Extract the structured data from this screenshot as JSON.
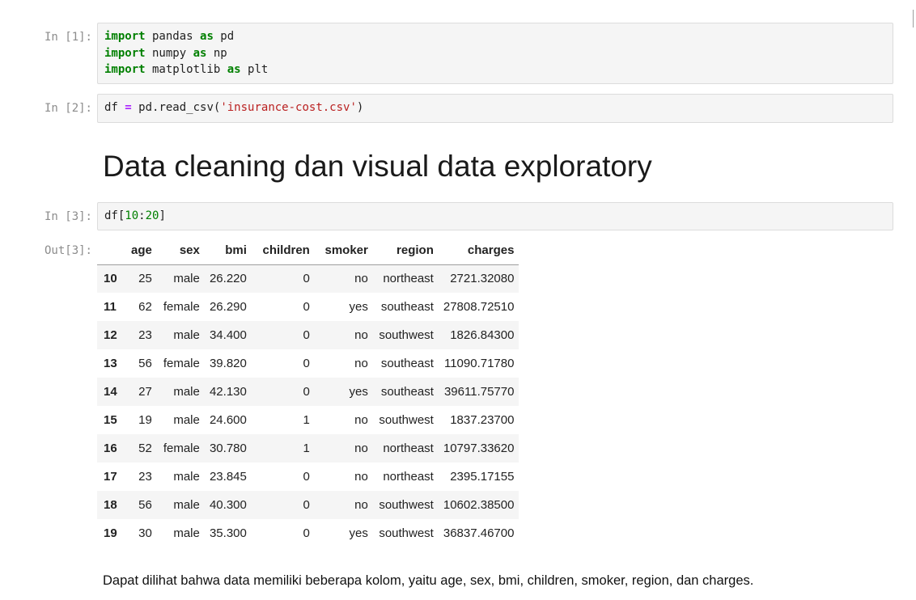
{
  "cells": [
    {
      "prompt": "In [1]:",
      "lines": [
        [
          {
            "t": "import",
            "c": "kw"
          },
          {
            "t": " pandas ",
            "c": ""
          },
          {
            "t": "as",
            "c": "kw"
          },
          {
            "t": " pd",
            "c": ""
          }
        ],
        [
          {
            "t": "import",
            "c": "kw"
          },
          {
            "t": " numpy ",
            "c": ""
          },
          {
            "t": "as",
            "c": "kw"
          },
          {
            "t": " np",
            "c": ""
          }
        ],
        [
          {
            "t": "import",
            "c": "kw"
          },
          {
            "t": " matplotlib ",
            "c": ""
          },
          {
            "t": "as",
            "c": "kw"
          },
          {
            "t": " plt",
            "c": ""
          }
        ]
      ]
    },
    {
      "prompt": "In [2]:",
      "lines": [
        [
          {
            "t": "df ",
            "c": ""
          },
          {
            "t": "=",
            "c": "op"
          },
          {
            "t": " pd.read_csv(",
            "c": ""
          },
          {
            "t": "'insurance-cost.csv'",
            "c": "str"
          },
          {
            "t": ")",
            "c": ""
          }
        ]
      ]
    },
    {
      "prompt": "In [3]:",
      "lines": [
        [
          {
            "t": "df[",
            "c": ""
          },
          {
            "t": "10",
            "c": "num"
          },
          {
            "t": ":",
            "c": ""
          },
          {
            "t": "20",
            "c": "num"
          },
          {
            "t": "]",
            "c": ""
          }
        ]
      ]
    }
  ],
  "heading": "Data cleaning dan visual data exploratory",
  "output": {
    "prompt": "Out[3]:",
    "columns": [
      "",
      "age",
      "sex",
      "bmi",
      "children",
      "smoker",
      "region",
      "charges"
    ],
    "rows": [
      [
        "10",
        "25",
        "male",
        "26.220",
        "0",
        "no",
        "northeast",
        "2721.32080"
      ],
      [
        "11",
        "62",
        "female",
        "26.290",
        "0",
        "yes",
        "southeast",
        "27808.72510"
      ],
      [
        "12",
        "23",
        "male",
        "34.400",
        "0",
        "no",
        "southwest",
        "1826.84300"
      ],
      [
        "13",
        "56",
        "female",
        "39.820",
        "0",
        "no",
        "southeast",
        "11090.71780"
      ],
      [
        "14",
        "27",
        "male",
        "42.130",
        "0",
        "yes",
        "southeast",
        "39611.75770"
      ],
      [
        "15",
        "19",
        "male",
        "24.600",
        "1",
        "no",
        "southwest",
        "1837.23700"
      ],
      [
        "16",
        "52",
        "female",
        "30.780",
        "1",
        "no",
        "northeast",
        "10797.33620"
      ],
      [
        "17",
        "23",
        "male",
        "23.845",
        "0",
        "no",
        "northeast",
        "2395.17155"
      ],
      [
        "18",
        "56",
        "male",
        "40.300",
        "0",
        "no",
        "southwest",
        "10602.38500"
      ],
      [
        "19",
        "30",
        "male",
        "35.300",
        "0",
        "yes",
        "southwest",
        "36837.46700"
      ]
    ]
  },
  "markdown": "Dapat dilihat bahwa data memiliki beberapa kolom, yaitu age, sex, bmi, children, smoker, region, dan charges."
}
